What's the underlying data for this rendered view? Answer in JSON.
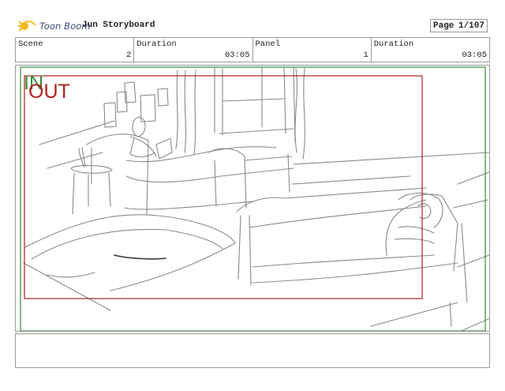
{
  "header": {
    "logo_text": "Toon Boom",
    "title": "Jun Storyboard",
    "page_label": "Page",
    "page_value": "1/107"
  },
  "info_bar": {
    "cells": [
      {
        "label": "Scene",
        "value": "2"
      },
      {
        "label": "Duration",
        "value": "03:05"
      },
      {
        "label": "Panel",
        "value": "1"
      },
      {
        "label": "Duration",
        "value": "03:05"
      }
    ]
  },
  "panel": {
    "in_label": "IN",
    "out_label": "OUT",
    "colors": {
      "in_frame": "#3a8a3a",
      "out_frame": "#b02020",
      "sketch": "#8a8a8a"
    }
  },
  "notes": {
    "text": ""
  }
}
